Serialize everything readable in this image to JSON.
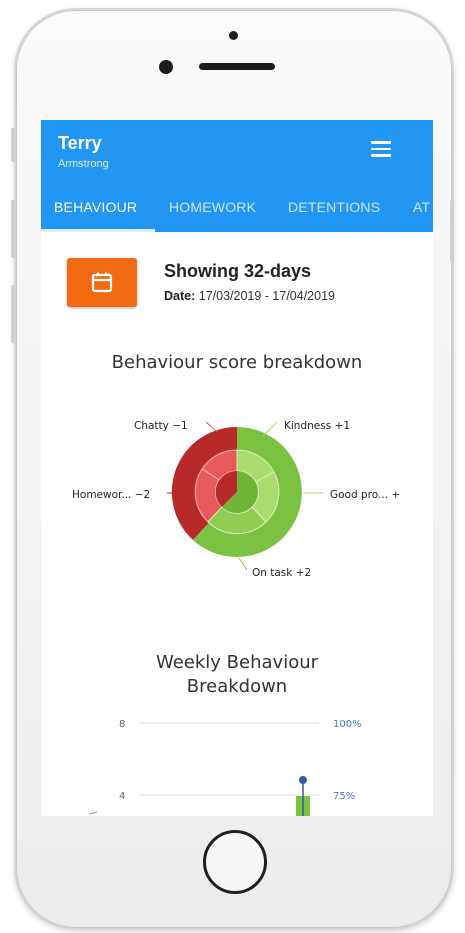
{
  "user": {
    "first_name": "Terry",
    "last_name": "Armstrong"
  },
  "tabs": [
    "BEHAVIOUR",
    "HOMEWORK",
    "DETENTIONS",
    "AT"
  ],
  "summary": {
    "title": "Showing 32-days",
    "date_label": "Date:",
    "date_range": "17/03/2019 - 17/04/2019"
  },
  "behaviour_chart": {
    "title": "Behaviour score breakdown",
    "labels": {
      "chatty": "Chatty −1",
      "kindness": "Kindness +1",
      "homework": "Homewor... −2",
      "good_progress": "Good pro... +",
      "on_task": "On task +2"
    },
    "colors": {
      "negative": "#b72a2a",
      "negative_light": "#e65a5a",
      "positive": "#7cc241",
      "positive_light": "#a9dc6e"
    }
  },
  "weekly_chart": {
    "title_line1": "Weekly Behaviour",
    "title_line2": "Breakdown",
    "y_ticks": [
      "8",
      "4"
    ],
    "pct_ticks": [
      "100%",
      "75%"
    ]
  },
  "chart_data": {
    "type": "bar",
    "title": "Weekly Behaviour Breakdown",
    "y_ticks": [
      8,
      4
    ],
    "right_ticks": [
      "100%",
      "75%"
    ]
  }
}
